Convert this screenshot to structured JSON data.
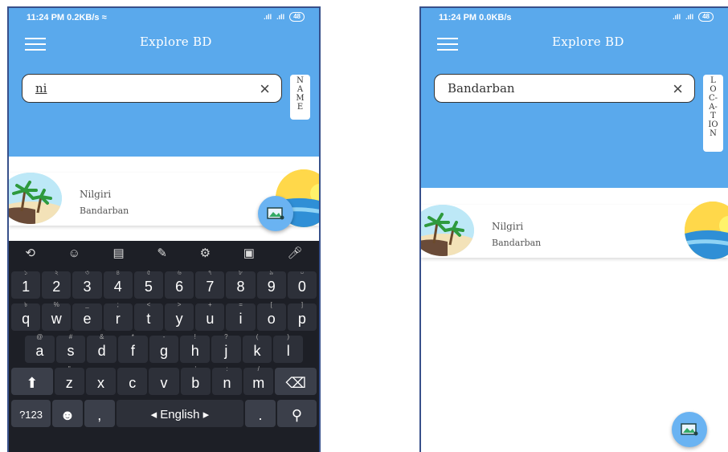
{
  "left_screen": {
    "status": {
      "time": "11:24 PM",
      "speed": "0.2KB/s",
      "battery": "48"
    },
    "app_title": "Explore BD",
    "search": {
      "value": "ni",
      "mode_tag": [
        "N",
        "A",
        "M",
        "E"
      ]
    },
    "result": {
      "name": "Nilgiri",
      "location": "Bandarban"
    },
    "keyboard": {
      "row1": [
        [
          "1",
          "১"
        ],
        [
          "2",
          "২"
        ],
        [
          "3",
          "৩"
        ],
        [
          "4",
          "৪"
        ],
        [
          "5",
          "৫"
        ],
        [
          "6",
          "৬"
        ],
        [
          "7",
          "৭"
        ],
        [
          "8",
          "৮"
        ],
        [
          "9",
          "৯"
        ],
        [
          "0",
          "০"
        ]
      ],
      "row2": [
        [
          "q",
          "৳"
        ],
        [
          "w",
          "%"
        ],
        [
          "e",
          "_"
        ],
        [
          "r",
          ";"
        ],
        [
          "t",
          "<"
        ],
        [
          "y",
          ">"
        ],
        [
          "u",
          "+"
        ],
        [
          "i",
          "="
        ],
        [
          "o",
          "["
        ],
        [
          "p",
          "]"
        ]
      ],
      "row3": [
        [
          "a",
          "@"
        ],
        [
          "s",
          "#"
        ],
        [
          "d",
          "&"
        ],
        [
          "f",
          "*"
        ],
        [
          "g",
          "-"
        ],
        [
          "h",
          "!"
        ],
        [
          "j",
          "?"
        ],
        [
          "k",
          "("
        ],
        [
          "l",
          ")"
        ]
      ],
      "row4": [
        [
          "z",
          "\""
        ],
        [
          "x",
          ""
        ],
        [
          "c",
          ""
        ],
        [
          "v",
          ""
        ],
        [
          "b",
          "'"
        ],
        [
          "n",
          ":"
        ],
        [
          "m",
          "/"
        ]
      ],
      "symbols_key": "?123",
      "comma_key": ",",
      "space_label": "English",
      "period_key": "."
    }
  },
  "right_screen": {
    "status": {
      "time": "11:24 PM",
      "speed": "0.0KB/s",
      "battery": "48"
    },
    "app_title": "Explore BD",
    "search": {
      "value": "Bandarban",
      "mode_tag": [
        "L",
        "O",
        "C-",
        "A-",
        "T",
        "IO",
        "N"
      ]
    },
    "result": {
      "name": "Nilgiri",
      "location": "Bandarban"
    }
  }
}
